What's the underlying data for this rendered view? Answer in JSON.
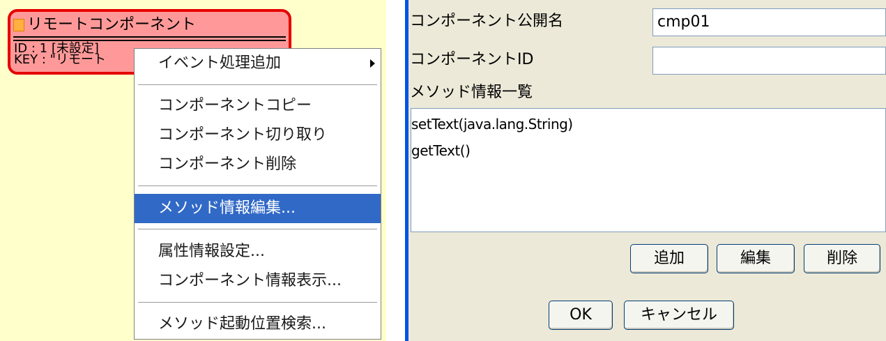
{
  "component": {
    "title": "リモートコンポーネント",
    "id_line": "ID : 1 [未設定]",
    "key_line": "KEY : \"リモート"
  },
  "context_menu": {
    "items": [
      {
        "label": "イベント処理追加",
        "submenu": true
      },
      {
        "label": "コンポーネントコピー"
      },
      {
        "label": "コンポーネント切り取り"
      },
      {
        "label": "コンポーネント削除"
      },
      {
        "label": "メソッド情報編集...",
        "selected": true
      },
      {
        "label": "属性情報設定..."
      },
      {
        "label": "コンポーネント情報表示..."
      },
      {
        "label": "メソッド起動位置検索..."
      }
    ]
  },
  "dialog": {
    "public_name_label": "コンポーネント公開名",
    "public_name_value": "cmp01",
    "component_id_label": "コンポーネントID",
    "component_id_value": "",
    "method_list_label": "メソッド情報一覧",
    "methods": [
      "setText(java.lang.String)",
      "getText()"
    ],
    "add_label": "追加",
    "edit_label": "編集",
    "delete_label": "削除",
    "ok_label": "OK",
    "cancel_label": "キャンセル"
  },
  "colors": {
    "canvas_bg": "#ffffcc",
    "component_fill": "#ff9999",
    "component_border": "#e60000",
    "menu_highlight": "#3169c6",
    "dialog_bg": "#ece9d8",
    "window_edge": "#0055e5"
  }
}
